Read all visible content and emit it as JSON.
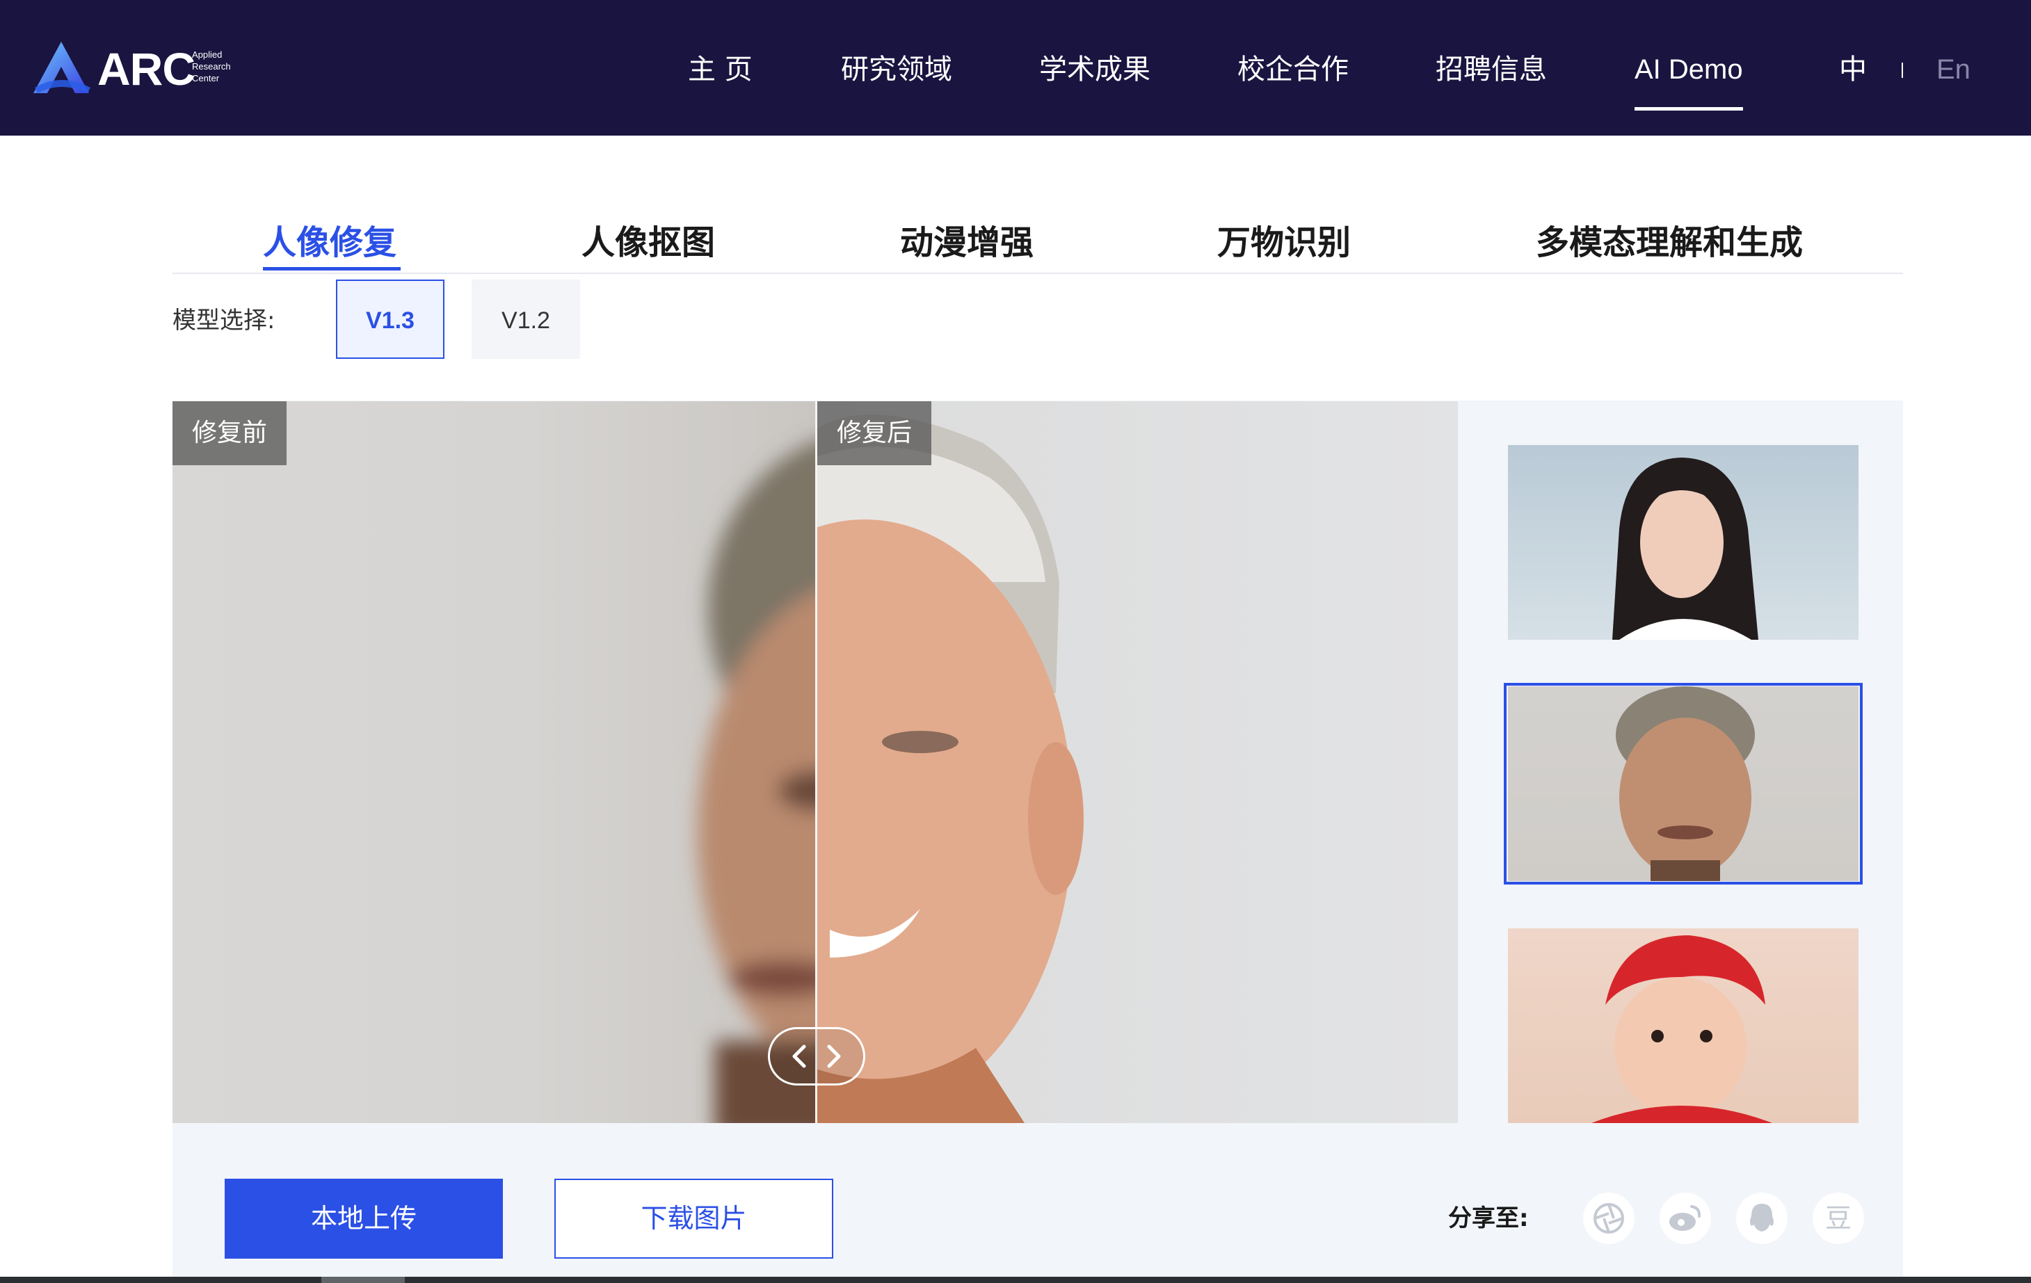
{
  "header": {
    "logo_text": "ARC",
    "logo_sub": [
      "Applied",
      "Research",
      "Center"
    ],
    "nav": [
      {
        "label": "主 页",
        "active": false
      },
      {
        "label": "研究领域",
        "active": false
      },
      {
        "label": "学术成果",
        "active": false
      },
      {
        "label": "校企合作",
        "active": false
      },
      {
        "label": "招聘信息",
        "active": false
      },
      {
        "label": "AI Demo",
        "active": true
      }
    ],
    "lang_zh": "中",
    "lang_en": "En"
  },
  "tabs": [
    {
      "label": "人像修复",
      "active": true
    },
    {
      "label": "人像抠图",
      "active": false
    },
    {
      "label": "动漫增强",
      "active": false
    },
    {
      "label": "万物识别",
      "active": false
    },
    {
      "label": "多模态理解和生成",
      "active": false
    }
  ],
  "model": {
    "label": "模型选择:",
    "versions": [
      {
        "label": "V1.3",
        "active": true
      },
      {
        "label": "V1.2",
        "active": false
      }
    ]
  },
  "compare": {
    "before_label": "修复前",
    "after_label": "修复后",
    "handle_icons": [
      "chevron-left-icon",
      "chevron-right-icon"
    ]
  },
  "samples": [
    {
      "name": "young-woman-portrait",
      "selected": false
    },
    {
      "name": "older-man-portrait",
      "selected": true
    },
    {
      "name": "baby-red-hat-portrait",
      "selected": false
    }
  ],
  "actions": {
    "upload_label": "本地上传",
    "download_label": "下载图片"
  },
  "share": {
    "label": "分享至:",
    "icons": [
      "aperture-icon",
      "weibo-icon",
      "qq-icon",
      "douban-icon"
    ],
    "douban_glyph": "豆"
  },
  "colors": {
    "header_bg": "#1a1440",
    "accent": "#2b50e6",
    "panel_bg": "#f2f5f9"
  }
}
